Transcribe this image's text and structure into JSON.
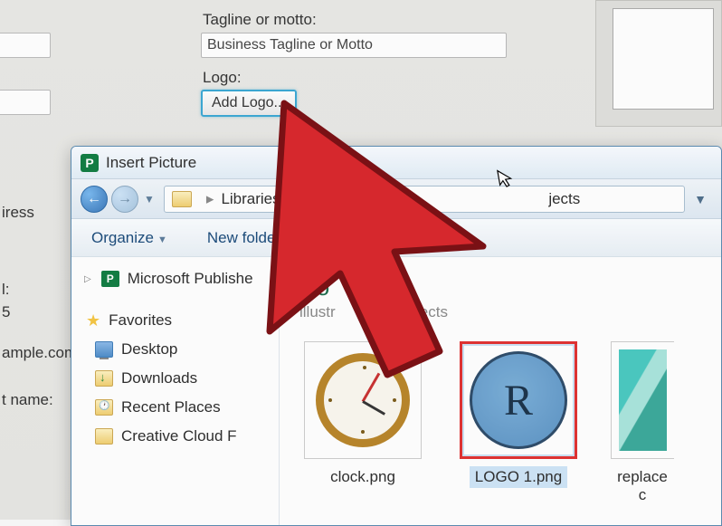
{
  "form": {
    "tagline_label": "Tagline or motto:",
    "tagline_value": "Business Tagline or Motto",
    "logo_label": "Logo:",
    "add_logo_button": "Add Logo...",
    "label_dress": "iress",
    "label_il": "l:",
    "val_5": "5",
    "val_sample": "ample.com",
    "label_tname": "t name:"
  },
  "dialog": {
    "title": "Insert Picture",
    "breadcrumb": {
      "libraries": "Libraries",
      "projects": "jects"
    },
    "toolbar": {
      "organize": "Organize",
      "new_folder": "New folder"
    },
    "sidebar": {
      "publisher": "Microsoft Publishe",
      "favorites": "Favorites",
      "desktop": "Desktop",
      "downloads": "Downloads",
      "recent": "Recent Places",
      "cc": "Creative Cloud F"
    },
    "library": {
      "title": "Do",
      "subtitle_prefix": "illustr",
      "subtitle_suffix": "projects"
    },
    "files": [
      {
        "name": "clock.png",
        "selected": false
      },
      {
        "name": "LOGO 1.png",
        "selected": true
      },
      {
        "name": "replace c",
        "selected": false
      }
    ]
  }
}
